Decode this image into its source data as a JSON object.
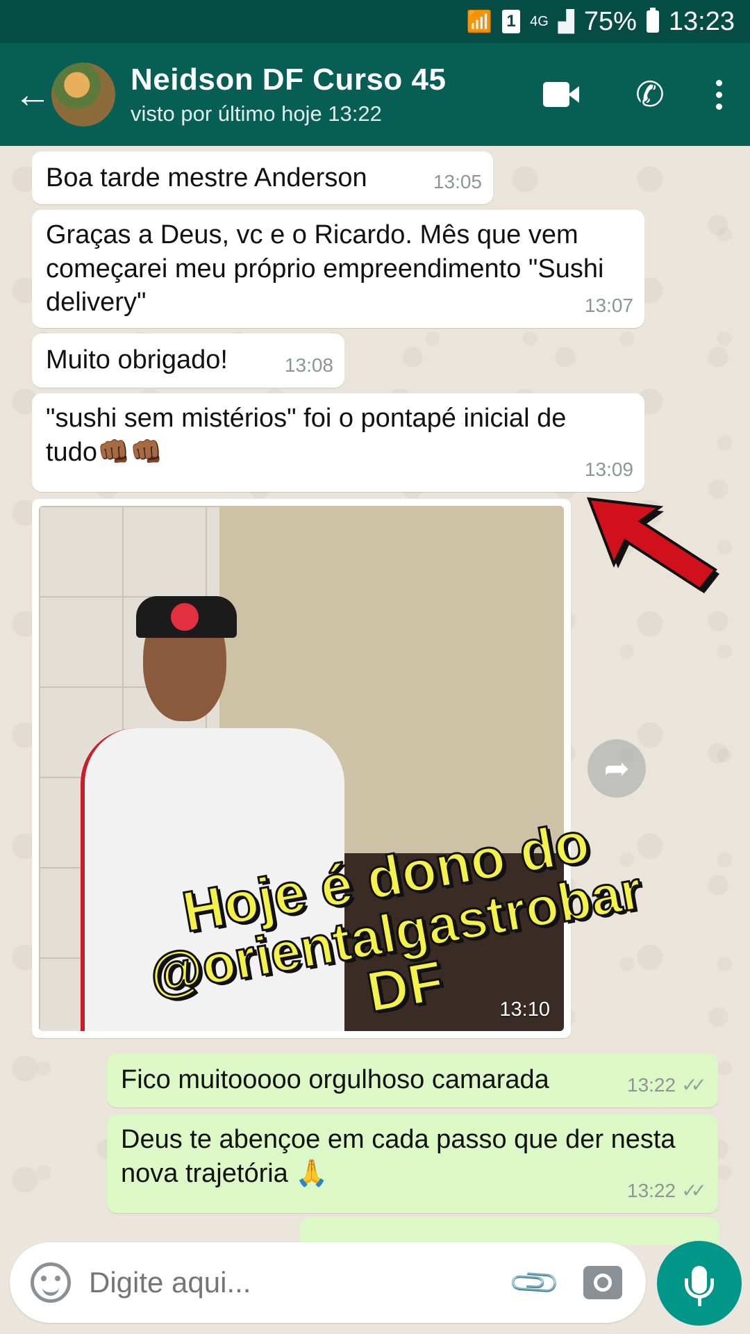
{
  "status_bar": {
    "battery": "75%",
    "time": "13:23",
    "network": "4G",
    "sim": "1"
  },
  "header": {
    "contact_name": "Neidson DF Curso 45",
    "contact_status": "visto por último hoje 13:22"
  },
  "messages": [
    {
      "text": "Boa tarde mestre Anderson",
      "time": "13:05"
    },
    {
      "text": "Graças a Deus, vc e o Ricardo. Mês que vem começarei meu próprio empreendimento \"Sushi delivery\"",
      "time": "13:07"
    },
    {
      "text": "Muito obrigado!",
      "time": "13:08"
    },
    {
      "text": "\"sushi sem mistérios\" foi o pontapé inicial de tudo👊🏾👊🏾",
      "time": "13:09"
    },
    {
      "text": "",
      "time": "13:10"
    },
    {
      "text": "Fico muitooooo orgulhoso camarada",
      "time": "13:22"
    },
    {
      "text": "Deus te abençoe em cada passo que der nesta nova trajetória 🙏",
      "time": "13:22"
    }
  ],
  "overlay_caption": {
    "line1": "Hoje é dono do",
    "line2": "@orientalgastrobar",
    "line3": "DF"
  },
  "input": {
    "placeholder": "Digite aqui..."
  },
  "colors": {
    "header": "#075e54",
    "status_bar": "#054d44",
    "outgoing": "#dcf8c6",
    "incoming": "#ffffff",
    "mic_button": "#009688",
    "caption": "#f4f24a",
    "arrow": "#d0101a"
  }
}
